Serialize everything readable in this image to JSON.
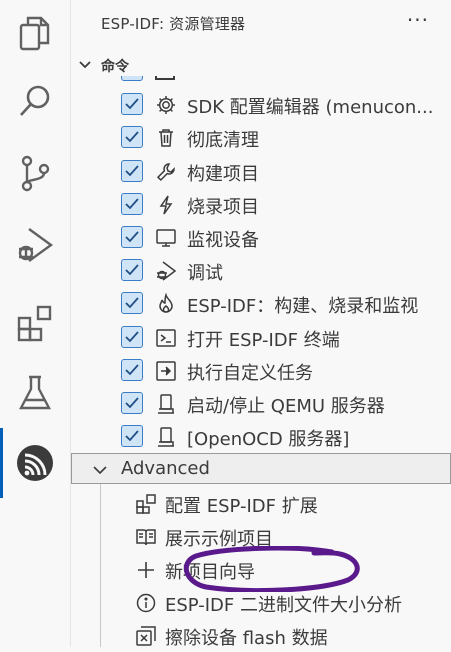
{
  "activity_bar": {
    "items": [
      {
        "name": "explorer-icon"
      },
      {
        "name": "search-icon"
      },
      {
        "name": "source-control-icon"
      },
      {
        "name": "run-debug-icon"
      },
      {
        "name": "extensions-icon"
      },
      {
        "name": "testing-icon"
      },
      {
        "name": "esp-idf-icon",
        "active": true
      }
    ]
  },
  "sidebar": {
    "title": "ESP-IDF: 资源管理器",
    "more": "···",
    "commands_section": {
      "label": "命令"
    },
    "commands": [
      {
        "label": "SDK 配置编辑器 (menucon...",
        "icon": "gear-icon",
        "checked": true
      },
      {
        "label": "彻底清理",
        "icon": "trash-icon",
        "checked": true
      },
      {
        "label": "构建项目",
        "icon": "wrench-icon",
        "checked": true
      },
      {
        "label": "烧录项目",
        "icon": "lightning-icon",
        "checked": true
      },
      {
        "label": "监视设备",
        "icon": "monitor-icon",
        "checked": true
      },
      {
        "label": "调试",
        "icon": "debug-icon",
        "checked": true
      },
      {
        "label": "ESP-IDF：构建、烧录和监视",
        "icon": "flame-icon",
        "checked": true
      },
      {
        "label": "打开 ESP-IDF 终端",
        "icon": "terminal-icon",
        "checked": true
      },
      {
        "label": "执行自定义任务",
        "icon": "arrow-box-icon",
        "checked": true
      },
      {
        "label": "启动/停止 QEMU 服务器",
        "icon": "server-icon",
        "checked": true
      },
      {
        "label": "[OpenOCD 服务器]",
        "icon": "server-icon",
        "checked": true
      }
    ],
    "advanced_section": {
      "label": "Advanced"
    },
    "advanced": [
      {
        "label": "配置 ESP-IDF 扩展",
        "icon": "extensions-icon"
      },
      {
        "label": "展示示例项目",
        "icon": "book-icon"
      },
      {
        "label": "新项目向导",
        "icon": "plus-icon"
      },
      {
        "label": "ESP-IDF 二进制文件大小分析",
        "icon": "info-icon"
      },
      {
        "label": "擦除设备 flash 数据",
        "icon": "erase-icon"
      }
    ]
  },
  "colors": {
    "accent": "#005fb8",
    "checkbox_fill": "#cfe4f7",
    "annotation": "#5b1a8c"
  }
}
